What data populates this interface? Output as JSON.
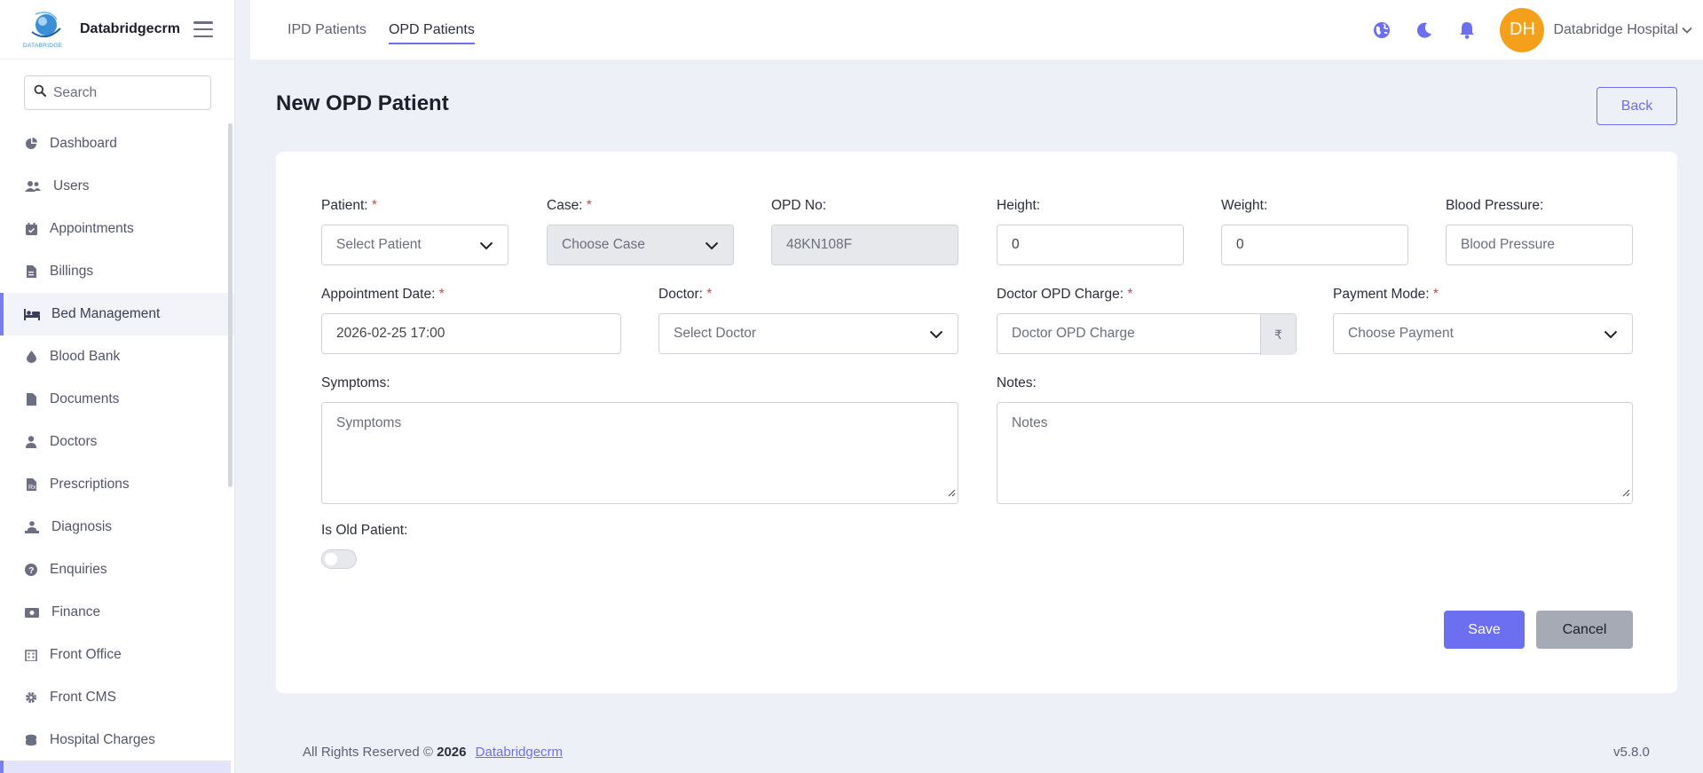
{
  "sidebar": {
    "app_name": "Databridgecrm",
    "logo_text": "DATABRIDGE",
    "search_placeholder": "Search",
    "items": [
      {
        "label": "Dashboard",
        "icon": "pie-chart-icon"
      },
      {
        "label": "Users",
        "icon": "users-icon"
      },
      {
        "label": "Appointments",
        "icon": "calendar-check-icon"
      },
      {
        "label": "Billings",
        "icon": "invoice-icon"
      },
      {
        "label": "Bed Management",
        "icon": "bed-icon",
        "active": true
      },
      {
        "label": "Blood Bank",
        "icon": "droplet-icon"
      },
      {
        "label": "Documents",
        "icon": "file-icon"
      },
      {
        "label": "Doctors",
        "icon": "doctor-icon"
      },
      {
        "label": "Prescriptions",
        "icon": "prescription-icon"
      },
      {
        "label": "Diagnosis",
        "icon": "diagnosis-icon"
      },
      {
        "label": "Enquiries",
        "icon": "question-circle-icon"
      },
      {
        "label": "Finance",
        "icon": "money-icon"
      },
      {
        "label": "Front Office",
        "icon": "building-icon"
      },
      {
        "label": "Front CMS",
        "icon": "gear-icon"
      },
      {
        "label": "Hospital Charges",
        "icon": "coins-icon"
      }
    ]
  },
  "header": {
    "tabs": [
      {
        "label": "IPD Patients",
        "active": false
      },
      {
        "label": "OPD Patients",
        "active": true
      }
    ],
    "avatar_initials": "DH",
    "user_name": "Databridge Hospital",
    "colors": {
      "accent": "#6c6ff0",
      "avatar": "#f5a01a"
    }
  },
  "page": {
    "title": "New OPD Patient",
    "back_label": "Back"
  },
  "form": {
    "patient": {
      "label": "Patient:",
      "placeholder": "Select Patient"
    },
    "case": {
      "label": "Case:",
      "placeholder": "Choose Case"
    },
    "opd_no": {
      "label": "OPD No:",
      "value": "48KN108F"
    },
    "height": {
      "label": "Height:",
      "value": "0"
    },
    "weight": {
      "label": "Weight:",
      "value": "0"
    },
    "blood_pressure": {
      "label": "Blood Pressure:",
      "placeholder": "Blood Pressure"
    },
    "appointment_date": {
      "label": "Appointment Date:",
      "value": "2026-02-25 17:00"
    },
    "doctor": {
      "label": "Doctor:",
      "placeholder": "Select Doctor"
    },
    "doctor_opd_charge": {
      "label": "Doctor OPD Charge:",
      "placeholder": "Doctor OPD Charge",
      "currency": "₹"
    },
    "payment_mode": {
      "label": "Payment Mode:",
      "placeholder": "Choose Payment"
    },
    "symptoms": {
      "label": "Symptoms:",
      "placeholder": "Symptoms"
    },
    "notes": {
      "label": "Notes:",
      "placeholder": "Notes"
    },
    "is_old_patient": {
      "label": "Is Old Patient:",
      "checked": false
    },
    "required_mark": "*",
    "save_label": "Save",
    "cancel_label": "Cancel"
  },
  "footer": {
    "rights": "All Rights Reserved ©",
    "year": "2026",
    "link": "Databridgecrm",
    "version": "v5.8.0"
  }
}
